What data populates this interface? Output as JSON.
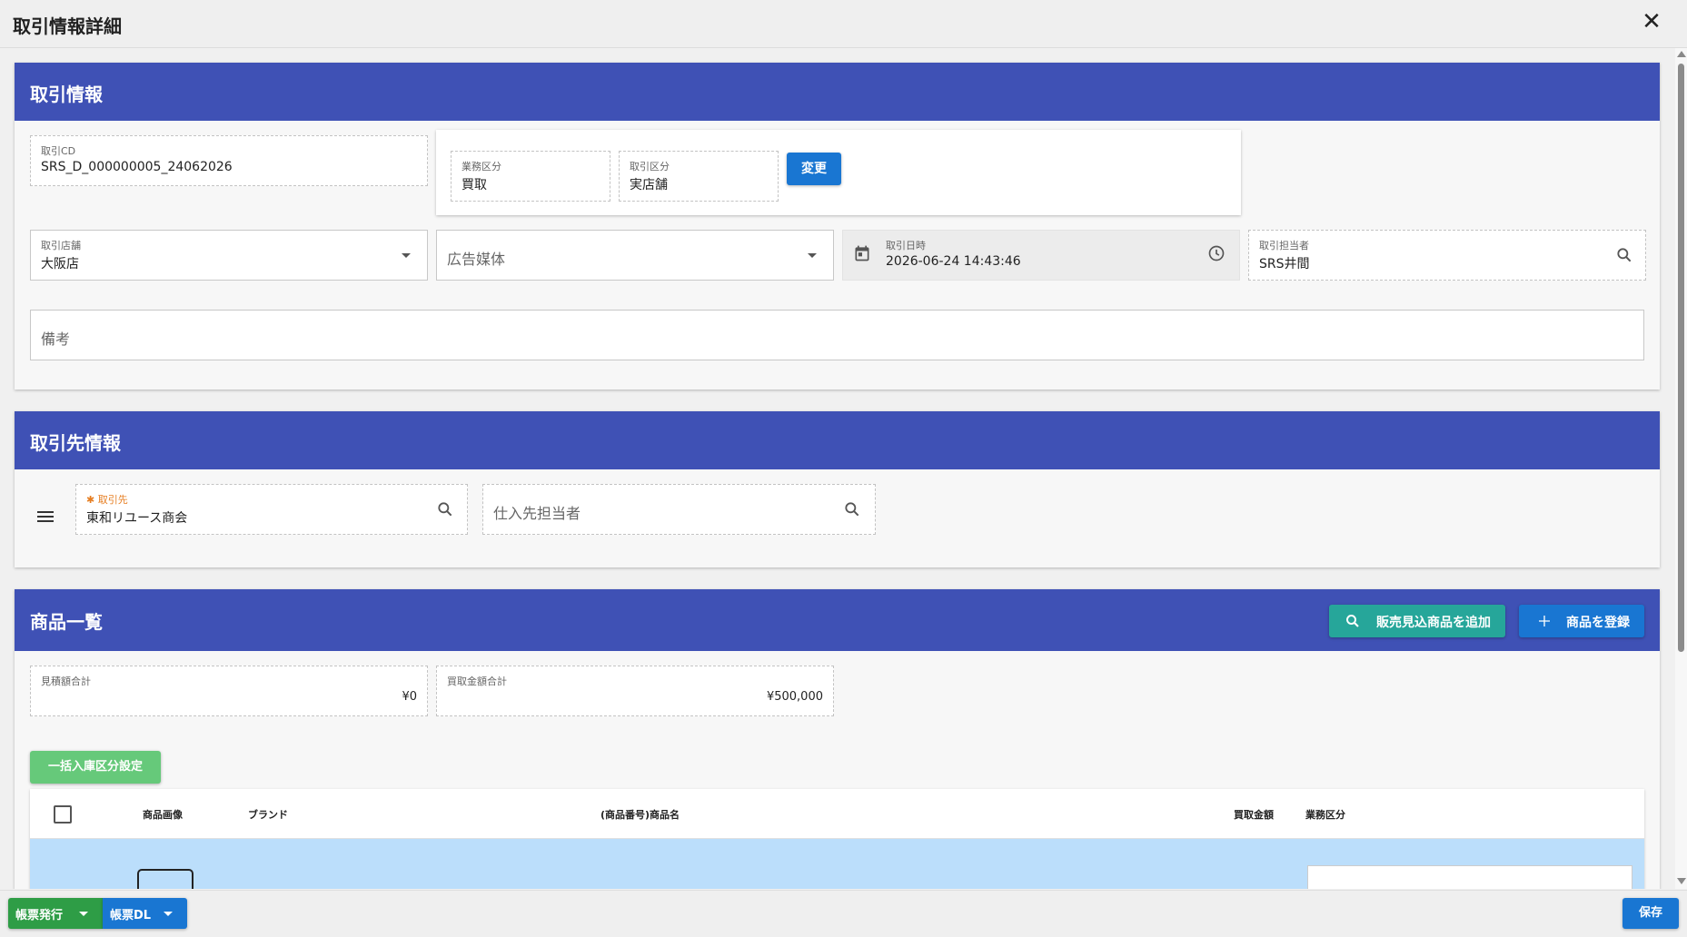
{
  "window": {
    "title": "取引情報詳細"
  },
  "transaction": {
    "header": "取引情報",
    "code_label": "取引CD",
    "code_value": "SRS_D_000000005_24062026",
    "business_label": "業務区分",
    "business_value": "買取",
    "category_label": "取引区分",
    "category_value": "実店舗",
    "change_button": "変更",
    "store_label": "取引店舗",
    "store_value": "大阪店",
    "media_placeholder": "広告媒体",
    "datetime_label": "取引日時",
    "datetime_value": "2026-06-24 14:43:46",
    "staff_label": "取引担当者",
    "staff_value": "SRS井間",
    "notes_placeholder": "備考"
  },
  "partner": {
    "header": "取引先情報",
    "partner_label": "取引先",
    "required_mark": "✱",
    "partner_value": "東和リユース商会",
    "contact_placeholder": "仕入先担当者"
  },
  "products": {
    "header": "商品一覧",
    "add_forecast_button": "販売見込商品を追加",
    "register_button": "商品を登録",
    "estimate_total_label": "見積額合計",
    "estimate_total_value": "¥0",
    "purchase_total_label": "買取金額合計",
    "purchase_total_value": "¥500,000",
    "bulk_button": "一括入庫区分設定",
    "columns": {
      "image": "商品画像",
      "brand": "ブランド",
      "name": "(商品番号)商品名",
      "price": "買取金額",
      "business": "業務区分"
    }
  },
  "footer": {
    "issue_button": "帳票発行",
    "download_button": "帳票DL",
    "save_button": "保存"
  },
  "colors": {
    "header": "#3f51b5",
    "primary_button": "#1976d2",
    "teal_button": "#26a69a",
    "green_button": "#66c97a",
    "issue_button": "#2e9d46",
    "row_highlight": "#bbdefb"
  }
}
